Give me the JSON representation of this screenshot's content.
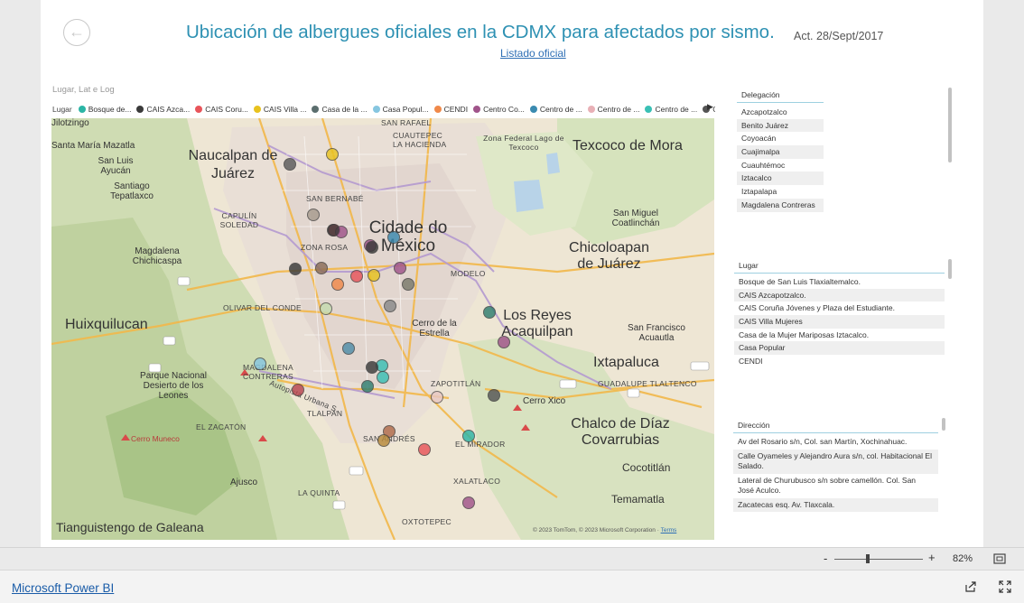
{
  "header": {
    "title": "Ubicación de albergues oficiales en la CDMX para afectados por sismo.",
    "date": "Act. 28/Sept/2017",
    "link": "Listado oficial"
  },
  "map": {
    "caption": "Lugar, Lat e Log",
    "legend_title": "Lugar",
    "legend_items": [
      {
        "label": "Bosque de...",
        "color": "#2bb5a5"
      },
      {
        "label": "CAIS Azca...",
        "color": "#3a3a3a"
      },
      {
        "label": "CAIS Coru...",
        "color": "#e8545a"
      },
      {
        "label": "CAIS Villa ...",
        "color": "#e8c21e"
      },
      {
        "label": "Casa de la ...",
        "color": "#5b6e6e"
      },
      {
        "label": "Casa Popul...",
        "color": "#86c6e0"
      },
      {
        "label": "CENDI",
        "color": "#f0894a"
      },
      {
        "label": "Centro Co...",
        "color": "#a0548a"
      },
      {
        "label": "Centro de ...",
        "color": "#3a8ab0"
      },
      {
        "label": "Centro de ...",
        "color": "#e8b0b6"
      },
      {
        "label": "Centro de ...",
        "color": "#3ac0b5"
      },
      {
        "label": "Centro de ...",
        "color": "#555555"
      }
    ],
    "legend_next": "▶",
    "labels": {
      "naucalpan": "Naucalpan de Juárez",
      "texcoco": "Texcoco de Mora",
      "cidade": "Cidade do México",
      "huixquilucan": "Huixquilucan",
      "los_reyes": "Los Reyes Acaquilpan",
      "ixtapaluca": "Ixtapaluca",
      "chalco": "Chalco de Díaz Covarrubias",
      "cocotitlan": "Cocotitlán",
      "temamatla": "Temamatla",
      "tianguistengo": "Tianguistengo de Galeana",
      "jilotzingo": "Jilotzingo",
      "santa_maria": "Santa María Mazatla",
      "san_luis": "San Luis Ayucán",
      "santiago": "Santiago Tepatlaxco",
      "magdalena": "Magdalena Chichicaspa",
      "chicoloapan": "Chicoloapan de Juárez",
      "san_miguel": "San Miguel Coatlinchán",
      "san_francisco": "San Francisco Acuautla",
      "zona_federal": "Zona Federal Lago de Texcoco",
      "cerro_estrella": "Cerro de la Estrella",
      "cerro_xico": "Cerro Xico",
      "parque": "Parque Nacional Desierto de los Leones",
      "cerro_munco": "Cerro Muneco",
      "ajusco": "Ajusco",
      "san_rafael": "SAN RAFAEL",
      "cuautepec": "CUAUTEPEC",
      "san_bernabe": "SAN BERNABÉ",
      "la_hacienda": "LA HACIENDA",
      "capulin": "CAPULÍN SOLEDAD",
      "zona_rosa": "ZONA ROSA",
      "modelo": "MODELO",
      "olivar": "OLIVAR DEL CONDE",
      "magdalena_c": "MAGDALENA CONTRERAS",
      "zapotitlan": "ZAPOTITLÁN",
      "guadalupe": "GUADALUPE TLALTENCO",
      "el_zacaton": "EL ZACATÓN",
      "tlalpan": "TLALPAN",
      "san_andres": "SAN ANDRÉS",
      "el_mirador": "EL MIRADOR",
      "xalatlaco": "XALATLACO",
      "la_quinta": "LA QUINTA",
      "oxtotepec": "OXTOTEPEC",
      "autopista": "Autopista Urbana S."
    },
    "attribution": "© 2023 TomTom, © 2023 Microsoft Corporation",
    "terms": "Terms"
  },
  "slicers": {
    "delegacion": {
      "header": "Delegación",
      "items": [
        "Azcapotzalco",
        "Benito Juárez",
        "Coyoacán",
        "Cuajimalpa",
        "Cuauhtémoc",
        "Iztacalco",
        "Iztapalapa",
        "Magdalena Contreras"
      ]
    },
    "lugar": {
      "header": "Lugar",
      "items": [
        "Bosque de San Luis Tlaxialtemalco.",
        "CAIS Azcapotzalco.",
        "CAIS Coruña Jóvenes y Plaza del Estudiante.",
        "CAIS Villa Mujeres",
        "Casa de la Mujer Mariposas Iztacalco.",
        "Casa Popular",
        "CENDI"
      ]
    },
    "direccion": {
      "header": "Dirección",
      "items": [
        "Av del Rosario s/n, Col. san Martín, Xochinahuac.",
        "Calle Oyameles y Alejandro Aura s/n, col. Habitacional El Salado.",
        "Lateral de Churubusco s/n sobre camellón. Col. San José Aculco.",
        "Zacatecas esq. Av. Tlaxcala."
      ]
    }
  },
  "zoom": {
    "minus": "-",
    "plus": "+",
    "level": "82%"
  },
  "footer": {
    "brand": "Microsoft Power BI"
  }
}
